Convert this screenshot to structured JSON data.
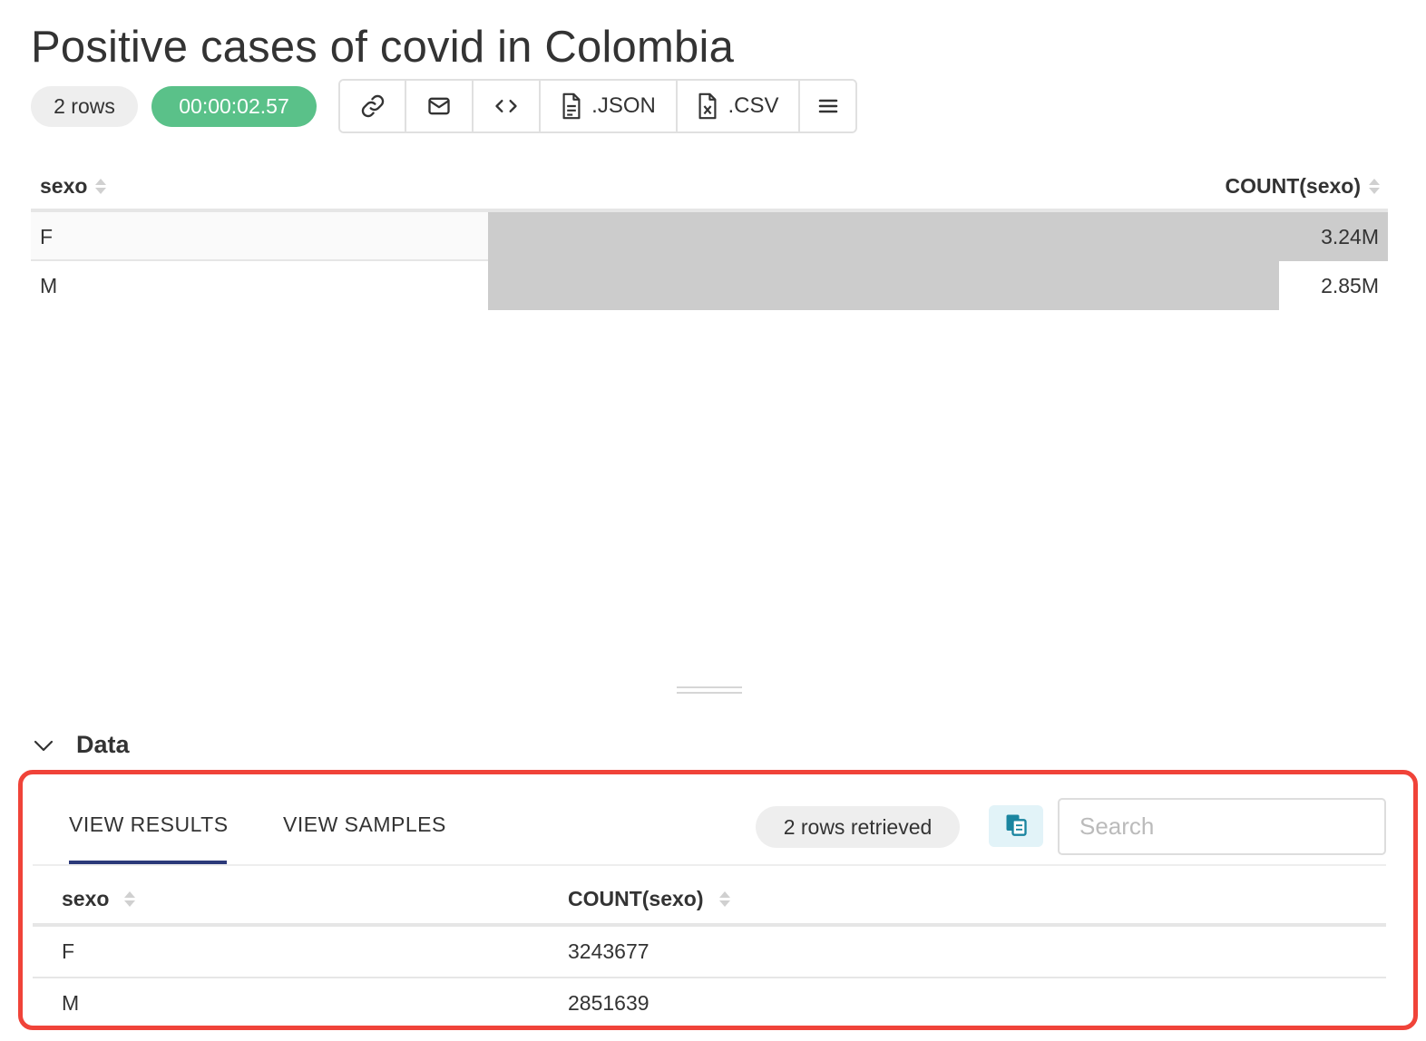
{
  "title": "Positive cases of covid in Colombia",
  "rows_badge": "2 rows",
  "timer": "00:00:02.57",
  "toolbar": {
    "link_icon": "link-icon",
    "email_icon": "mail-icon",
    "embed_icon": "code-icon",
    "json_label": ".JSON",
    "csv_label": ".CSV",
    "menu_icon": "hamburger-menu-icon"
  },
  "top_table": {
    "col1": "sexo",
    "col2": "COUNT(sexo)",
    "rows": [
      {
        "label": "F",
        "value": "3.24M",
        "fraction": 1.0
      },
      {
        "label": "M",
        "value": "2.85M",
        "fraction": 0.879
      }
    ]
  },
  "data_section": {
    "title": "Data",
    "tabs": [
      "VIEW RESULTS",
      "VIEW SAMPLES"
    ],
    "rows_retrieved": "2 rows retrieved",
    "search_placeholder": "Search",
    "col1": "sexo",
    "col2": "COUNT(sexo)",
    "rows": [
      {
        "sexo": "F",
        "count": "3243677"
      },
      {
        "sexo": "M",
        "count": "2851639"
      }
    ]
  },
  "colors": {
    "timer_bg": "#5ac189",
    "bar": "#cccccc",
    "highlight": "#f04339",
    "tab_underline": "#2c3a7a",
    "copy_icon": "#1a85a0"
  }
}
